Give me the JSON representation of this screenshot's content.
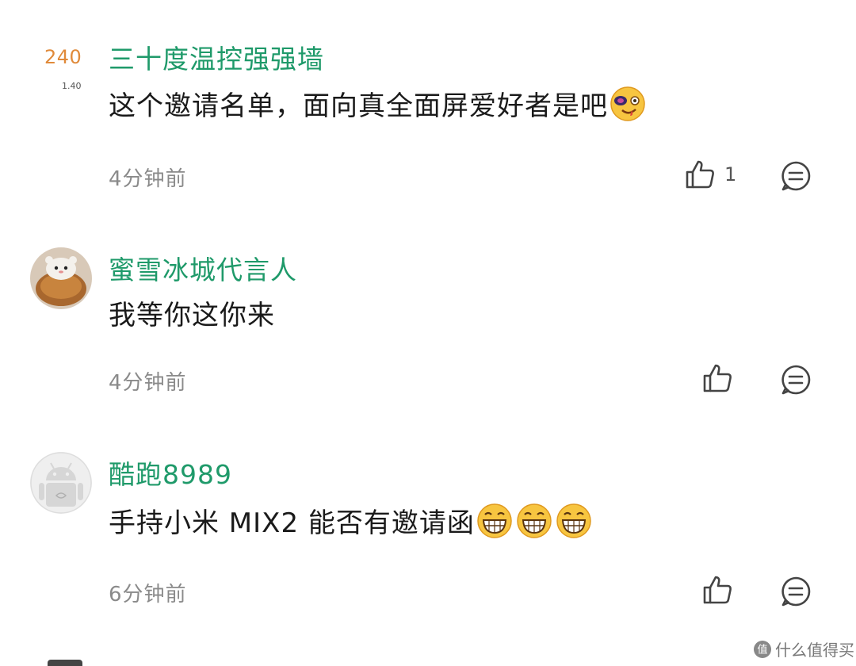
{
  "comments": [
    {
      "username": "三十度温控强强墙",
      "content": "这个邀请名单，面向真全面屏爱好者是吧",
      "time": "4分钟前",
      "likes": "1",
      "side_badge": "240",
      "side_badge_sub": "1.40",
      "emojis": [
        "cool-face-emoji"
      ]
    },
    {
      "username": "蜜雪冰城代言人",
      "content": "我等你这你来",
      "time": "4分钟前",
      "likes": "",
      "avatar": "snow-cake-avatar"
    },
    {
      "username": "酷跑8989",
      "content": "手持小米 MIX2 能否有邀请函",
      "time": "6分钟前",
      "likes": "",
      "avatar": "android-robot-avatar",
      "emojis": [
        "grinning-face-emoji",
        "grinning-face-emoji",
        "grinning-face-emoji"
      ]
    }
  ],
  "icons": {
    "like": "thumbs-up-icon",
    "reply": "comment-icon"
  },
  "colors": {
    "username": "#1f9a6a",
    "text": "#1a1a1a",
    "time": "#8a8a8a",
    "badge": "#e08a3a"
  },
  "watermark": {
    "text": "什么值得买"
  }
}
